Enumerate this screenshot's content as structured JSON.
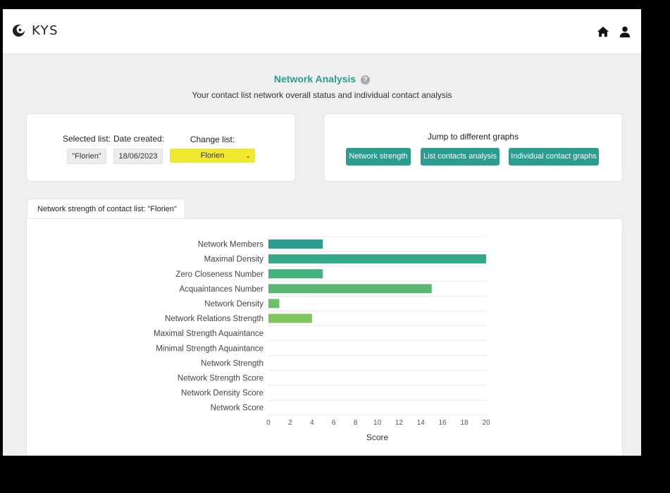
{
  "app": {
    "brand": "KYS"
  },
  "nav": {
    "home_icon": "home-icon",
    "user_icon": "user-icon"
  },
  "header": {
    "title": "Network Analysis",
    "help": "?",
    "subtitle": "Your contact list network overall status and individual contact analysis"
  },
  "list_info": {
    "selected_label": "Selected list:",
    "selected_value": "\"Florien\"",
    "date_label": "Date created:",
    "date_value": "18/06/2023",
    "change_label": "Change list:",
    "change_value": "Florien"
  },
  "jump": {
    "title": "Jump to different graphs",
    "buttons": [
      "Network strength",
      "List contacts analysis",
      "Individual contact graphs"
    ]
  },
  "tab": {
    "label_prefix": "Network strength of contact list:",
    "label_list": " \"Florien\""
  },
  "colors": {
    "accent": "#2a9d8f",
    "select_bg": "#eee92f",
    "bars": [
      "#2a9d8f",
      "#35a88a",
      "#44b27f",
      "#5bb874",
      "#6cc06a",
      "#80c55f"
    ]
  },
  "chart_data": {
    "type": "bar",
    "orientation": "horizontal",
    "categories": [
      "Network Members",
      "Maximal Density",
      "Zero Closeness Number",
      "Acquaintances Number",
      "Network Density",
      "Network Relations Strength",
      "Maximal Strength Aquaintance",
      "Minimal Strength Aquaintance",
      "Network Strength",
      "Network Strength Score",
      "Network Density Score",
      "Network Score"
    ],
    "values": [
      5,
      20,
      5,
      15,
      1,
      4,
      0,
      0,
      0,
      0,
      0,
      0
    ],
    "xlabel": "Score",
    "ylabel": "",
    "xlim": [
      0,
      20
    ],
    "xticks": [
      0,
      2,
      4,
      6,
      8,
      10,
      12,
      14,
      16,
      18,
      20
    ],
    "grid": true
  }
}
